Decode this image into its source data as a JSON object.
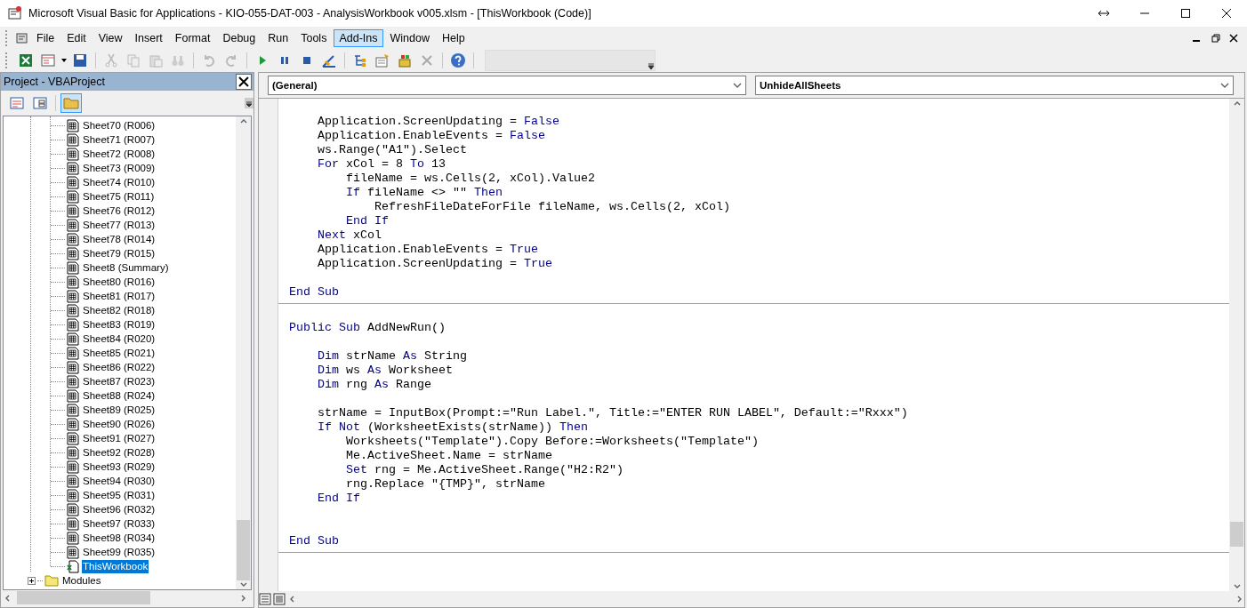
{
  "window": {
    "title": "Microsoft Visual Basic for Applications - KIO-055-DAT-003 - AnalysisWorkbook v005.xlsm - [ThisWorkbook (Code)]"
  },
  "menu": [
    {
      "label": "File",
      "selected": false
    },
    {
      "label": "Edit",
      "selected": false
    },
    {
      "label": "View",
      "selected": false
    },
    {
      "label": "Insert",
      "selected": false
    },
    {
      "label": "Format",
      "selected": false
    },
    {
      "label": "Debug",
      "selected": false
    },
    {
      "label": "Run",
      "selected": false
    },
    {
      "label": "Tools",
      "selected": false
    },
    {
      "label": "Add-Ins",
      "selected": true
    },
    {
      "label": "Window",
      "selected": false
    },
    {
      "label": "Help",
      "selected": false
    }
  ],
  "project": {
    "title": "Project - VBAProject",
    "items": [
      {
        "label": "Sheet70 (R006)",
        "kind": "sheet",
        "selected": false
      },
      {
        "label": "Sheet71 (R007)",
        "kind": "sheet",
        "selected": false
      },
      {
        "label": "Sheet72 (R008)",
        "kind": "sheet",
        "selected": false
      },
      {
        "label": "Sheet73 (R009)",
        "kind": "sheet",
        "selected": false
      },
      {
        "label": "Sheet74 (R010)",
        "kind": "sheet",
        "selected": false
      },
      {
        "label": "Sheet75 (R011)",
        "kind": "sheet",
        "selected": false
      },
      {
        "label": "Sheet76 (R012)",
        "kind": "sheet",
        "selected": false
      },
      {
        "label": "Sheet77 (R013)",
        "kind": "sheet",
        "selected": false
      },
      {
        "label": "Sheet78 (R014)",
        "kind": "sheet",
        "selected": false
      },
      {
        "label": "Sheet79 (R015)",
        "kind": "sheet",
        "selected": false
      },
      {
        "label": "Sheet8 (Summary)",
        "kind": "sheet",
        "selected": false
      },
      {
        "label": "Sheet80 (R016)",
        "kind": "sheet",
        "selected": false
      },
      {
        "label": "Sheet81 (R017)",
        "kind": "sheet",
        "selected": false
      },
      {
        "label": "Sheet82 (R018)",
        "kind": "sheet",
        "selected": false
      },
      {
        "label": "Sheet83 (R019)",
        "kind": "sheet",
        "selected": false
      },
      {
        "label": "Sheet84 (R020)",
        "kind": "sheet",
        "selected": false
      },
      {
        "label": "Sheet85 (R021)",
        "kind": "sheet",
        "selected": false
      },
      {
        "label": "Sheet86 (R022)",
        "kind": "sheet",
        "selected": false
      },
      {
        "label": "Sheet87 (R023)",
        "kind": "sheet",
        "selected": false
      },
      {
        "label": "Sheet88 (R024)",
        "kind": "sheet",
        "selected": false
      },
      {
        "label": "Sheet89 (R025)",
        "kind": "sheet",
        "selected": false
      },
      {
        "label": "Sheet90 (R026)",
        "kind": "sheet",
        "selected": false
      },
      {
        "label": "Sheet91 (R027)",
        "kind": "sheet",
        "selected": false
      },
      {
        "label": "Sheet92 (R028)",
        "kind": "sheet",
        "selected": false
      },
      {
        "label": "Sheet93 (R029)",
        "kind": "sheet",
        "selected": false
      },
      {
        "label": "Sheet94 (R030)",
        "kind": "sheet",
        "selected": false
      },
      {
        "label": "Sheet95 (R031)",
        "kind": "sheet",
        "selected": false
      },
      {
        "label": "Sheet96 (R032)",
        "kind": "sheet",
        "selected": false
      },
      {
        "label": "Sheet97 (R033)",
        "kind": "sheet",
        "selected": false
      },
      {
        "label": "Sheet98 (R034)",
        "kind": "sheet",
        "selected": false
      },
      {
        "label": "Sheet99 (R035)",
        "kind": "sheet",
        "selected": false
      },
      {
        "label": "ThisWorkbook",
        "kind": "workbook",
        "selected": true
      }
    ],
    "folder": {
      "label": "Modules",
      "expanded": false
    }
  },
  "code": {
    "object": "(General)",
    "procedure": "UnhideAllSheets",
    "procedures": [
      {
        "lines": [
          {
            "kind": "blank"
          },
          {
            "kind": "code",
            "segments": [
              {
                "text": "    Application.ScreenUpdating = ",
                "kind": "plain"
              },
              {
                "text": "False",
                "kind": "keyword"
              }
            ]
          },
          {
            "kind": "code",
            "segments": [
              {
                "text": "    Application.EnableEvents = ",
                "kind": "plain"
              },
              {
                "text": "False",
                "kind": "keyword"
              }
            ]
          },
          {
            "kind": "code",
            "segments": [
              {
                "text": "    ws.Range(\"A1\").Select",
                "kind": "plain"
              }
            ]
          },
          {
            "kind": "code",
            "segments": [
              {
                "text": "    For",
                "kind": "keyword"
              },
              {
                "text": " xCol = 8 ",
                "kind": "plain"
              },
              {
                "text": "To",
                "kind": "keyword"
              },
              {
                "text": " 13",
                "kind": "plain"
              }
            ]
          },
          {
            "kind": "code",
            "segments": [
              {
                "text": "        fileName = ws.Cells(2, xCol).Value2",
                "kind": "plain"
              }
            ]
          },
          {
            "kind": "code",
            "segments": [
              {
                "text": "        If",
                "kind": "keyword"
              },
              {
                "text": " fileName <> \"\" ",
                "kind": "plain"
              },
              {
                "text": "Then",
                "kind": "keyword"
              }
            ]
          },
          {
            "kind": "code",
            "segments": [
              {
                "text": "            RefreshFileDateForFile fileName, ws.Cells(2, xCol)",
                "kind": "plain"
              }
            ]
          },
          {
            "kind": "code",
            "segments": [
              {
                "text": "        End If",
                "kind": "keyword"
              }
            ]
          },
          {
            "kind": "code",
            "segments": [
              {
                "text": "    Next",
                "kind": "keyword"
              },
              {
                "text": " xCol",
                "kind": "plain"
              }
            ]
          },
          {
            "kind": "code",
            "segments": [
              {
                "text": "    Application.EnableEvents = ",
                "kind": "plain"
              },
              {
                "text": "True",
                "kind": "keyword"
              }
            ]
          },
          {
            "kind": "code",
            "segments": [
              {
                "text": "    Application.ScreenUpdating = ",
                "kind": "plain"
              },
              {
                "text": "True",
                "kind": "keyword"
              }
            ]
          },
          {
            "kind": "blank"
          },
          {
            "kind": "code",
            "segments": [
              {
                "text": "End Sub",
                "kind": "keyword"
              }
            ]
          }
        ]
      },
      {
        "lines": [
          {
            "kind": "blank"
          },
          {
            "kind": "code",
            "segments": [
              {
                "text": "Public Sub",
                "kind": "keyword"
              },
              {
                "text": " AddNewRun()",
                "kind": "plain"
              }
            ]
          },
          {
            "kind": "blank"
          },
          {
            "kind": "code",
            "segments": [
              {
                "text": "    Dim",
                "kind": "keyword"
              },
              {
                "text": " strName ",
                "kind": "plain"
              },
              {
                "text": "As",
                "kind": "keyword"
              },
              {
                "text": " String",
                "kind": "plain"
              }
            ]
          },
          {
            "kind": "code",
            "segments": [
              {
                "text": "    Dim",
                "kind": "keyword"
              },
              {
                "text": " ws ",
                "kind": "plain"
              },
              {
                "text": "As",
                "kind": "keyword"
              },
              {
                "text": " Worksheet",
                "kind": "plain"
              }
            ]
          },
          {
            "kind": "code",
            "segments": [
              {
                "text": "    Dim",
                "kind": "keyword"
              },
              {
                "text": " rng ",
                "kind": "plain"
              },
              {
                "text": "As",
                "kind": "keyword"
              },
              {
                "text": " Range",
                "kind": "plain"
              }
            ]
          },
          {
            "kind": "blank"
          },
          {
            "kind": "code",
            "segments": [
              {
                "text": "    strName = InputBox(Prompt:=\"Run Label.\", Title:=\"ENTER RUN LABEL\", Default:=\"Rxxx\")",
                "kind": "plain"
              }
            ]
          },
          {
            "kind": "code",
            "segments": [
              {
                "text": "    If Not",
                "kind": "keyword"
              },
              {
                "text": " (WorksheetExists(strName)) ",
                "kind": "plain"
              },
              {
                "text": "Then",
                "kind": "keyword"
              }
            ]
          },
          {
            "kind": "code",
            "segments": [
              {
                "text": "        Worksheets(\"Template\").Copy Before:=Worksheets(\"Template\")",
                "kind": "plain"
              }
            ]
          },
          {
            "kind": "code",
            "segments": [
              {
                "text": "        Me.ActiveSheet.Name = strName",
                "kind": "plain"
              }
            ]
          },
          {
            "kind": "code",
            "segments": [
              {
                "text": "        Set",
                "kind": "keyword"
              },
              {
                "text": " rng = Me.ActiveSheet.Range(\"H2:R2\")",
                "kind": "plain"
              }
            ]
          },
          {
            "kind": "code",
            "segments": [
              {
                "text": "        rng.Replace \"{TMP}\", strName",
                "kind": "plain"
              }
            ]
          },
          {
            "kind": "code",
            "segments": [
              {
                "text": "    End If",
                "kind": "keyword"
              }
            ]
          },
          {
            "kind": "blank"
          },
          {
            "kind": "blank"
          },
          {
            "kind": "code",
            "segments": [
              {
                "text": "End Sub",
                "kind": "keyword"
              }
            ]
          }
        ]
      }
    ]
  }
}
